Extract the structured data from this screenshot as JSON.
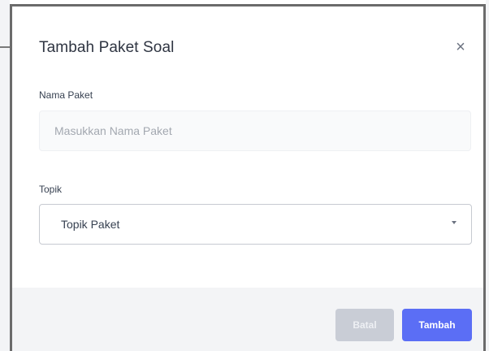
{
  "modal": {
    "title": "Tambah Paket Soal",
    "close_label": "×"
  },
  "form": {
    "nama_paket": {
      "label": "Nama Paket",
      "placeholder": "Masukkan Nama Paket",
      "value": ""
    },
    "topik": {
      "label": "Topik",
      "selected": "Topik Paket"
    }
  },
  "footer": {
    "cancel_label": "Batal",
    "submit_label": "Tambah"
  },
  "colors": {
    "primary": "#5b6ef5",
    "cancel": "#c9cdd6",
    "footer_bg": "#f3f4f6"
  }
}
